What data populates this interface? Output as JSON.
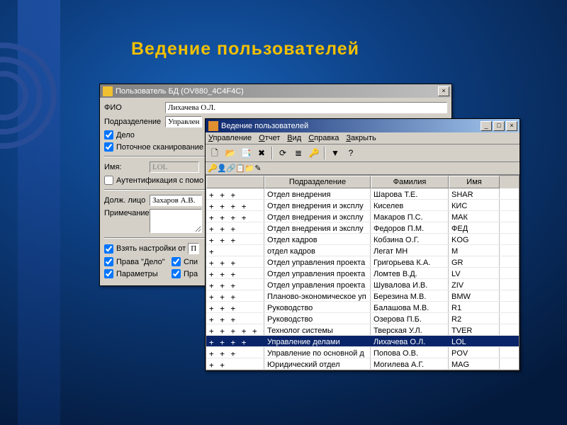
{
  "page": {
    "title": "Ведение пользователей"
  },
  "bg_window": {
    "title": "Пользователь БД   (OV880_4C4F4C)",
    "labels": {
      "fio": "ФИО",
      "dept": "Подразделение",
      "doc": "Дело",
      "scan": "Поточное сканирование",
      "name": "Имя:",
      "auth": "Аутентификация с помо",
      "person": "Долж. лицо",
      "note": "Примечание",
      "take_from": "Взять настройки от",
      "rights": "Права \"Дело\"",
      "params": "Параметры",
      "lists": "Спи",
      "rights2": "Пра"
    },
    "values": {
      "fio": "Лихачева О.Л.",
      "dept": "Управлен",
      "name": "LOL",
      "person": "Захаров А.В.",
      "take_from_sel": "П"
    },
    "checks": {
      "doc": true,
      "scan": true,
      "auth": false,
      "take_from": true,
      "rights": true,
      "params": true,
      "lists": true,
      "rights2": true
    }
  },
  "front_window": {
    "title": "Ведение пользователей",
    "menu": [
      "Управление",
      "Отчет",
      "Вид",
      "Справка",
      "Закрыть"
    ],
    "toolbar_icons": [
      "new-icon",
      "open-icon",
      "copy-icon",
      "delete-icon",
      "refresh-icon",
      "list-icon",
      "keys-icon",
      "filter-icon",
      "help-icon"
    ],
    "columns": {
      "flags": "",
      "dept": "Подразделение",
      "fam": "Фамилия",
      "name": "Имя"
    },
    "rows": [
      {
        "f": " +  +      +",
        "dept": "Отдел внедрения",
        "fam": "Шарова Т.Е.",
        "name": "SHAR"
      },
      {
        "f": " +  +  +   +",
        "dept": "Отдел внедрения и эксплу",
        "fam": "Киселев",
        "name": "КИС"
      },
      {
        "f": " +  +  +   +",
        "dept": "Отдел внедрения и эксплу",
        "fam": "Макаров П.С.",
        "name": "МАК"
      },
      {
        "f": " +  +      +",
        "dept": "Отдел внедрения и эксплу",
        "fam": "Федоров П.М.",
        "name": "ФЕД"
      },
      {
        "f": " +  +      +",
        "dept": "Отдел кадров",
        "fam": "Кобзина О.Г.",
        "name": "KOG"
      },
      {
        "f": " +",
        "dept": "отдел кадров",
        "fam": "Легат МН",
        "name": "М"
      },
      {
        "f": " +  +      +",
        "dept": "Отдел управления проекта",
        "fam": "Григорьева К.А.",
        "name": "GR"
      },
      {
        "f": " +  +      +",
        "dept": "Отдел управления проекта",
        "fam": "Ломтев В.Д.",
        "name": "LV"
      },
      {
        "f": " +  +      +",
        "dept": "Отдел управления проекта",
        "fam": "Шувалова И.В.",
        "name": "ZIV"
      },
      {
        "f": " +  +      +",
        "dept": "Планово-экономическое уп",
        "fam": "Березина М.В.",
        "name": "BMW"
      },
      {
        "f": " +  +      +",
        "dept": "Руководство",
        "fam": "Балашова М.В.",
        "name": "R1"
      },
      {
        "f": " +  +      +",
        "dept": "Руководство",
        "fam": "Озерова П.Б.",
        "name": "R2"
      },
      {
        "f": " +  + + + + +",
        "dept": "Технолог системы",
        "fam": "Тверская У.Л.",
        "name": "TVER"
      },
      {
        "f": " +  +   + +",
        "dept": "Управление делами",
        "fam": "Лихачева О.Л.",
        "name": "LOL",
        "sel": true
      },
      {
        "f": " +  +      +",
        "dept": "Управление по основной д",
        "fam": "Попова О.В.",
        "name": "POV"
      },
      {
        "f": " +  +",
        "dept": "Юридический отдел",
        "fam": "Могилева А.Г.",
        "name": "MAG"
      }
    ]
  }
}
